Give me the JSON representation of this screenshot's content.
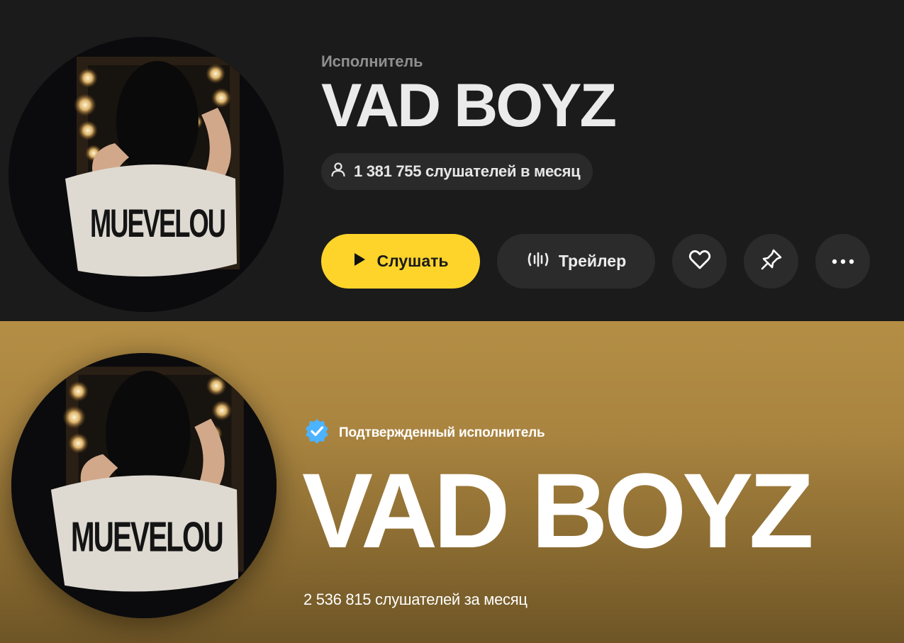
{
  "yandex": {
    "subtitle": "Исполнитель",
    "artist_name": "VAD BOYZ",
    "listeners_text": "1 381 755 слушателей в месяц",
    "play_label": "Слушать",
    "trailer_label": "Трейлер",
    "accent_color": "#fed42b",
    "icons": [
      "user-icon",
      "play-icon",
      "waveform-icon",
      "heart-icon",
      "pin-icon",
      "more-icon"
    ]
  },
  "spotify": {
    "verified_label": "Подтвержденный исполнитель",
    "artist_name": "VAD BOYZ",
    "listeners_text": "2 536 815 слушателей за месяц",
    "banner_color": "#b48e44",
    "badge_color": "#4cb3ff"
  },
  "avatar": {
    "shirt_text": "MUEVELOU"
  }
}
